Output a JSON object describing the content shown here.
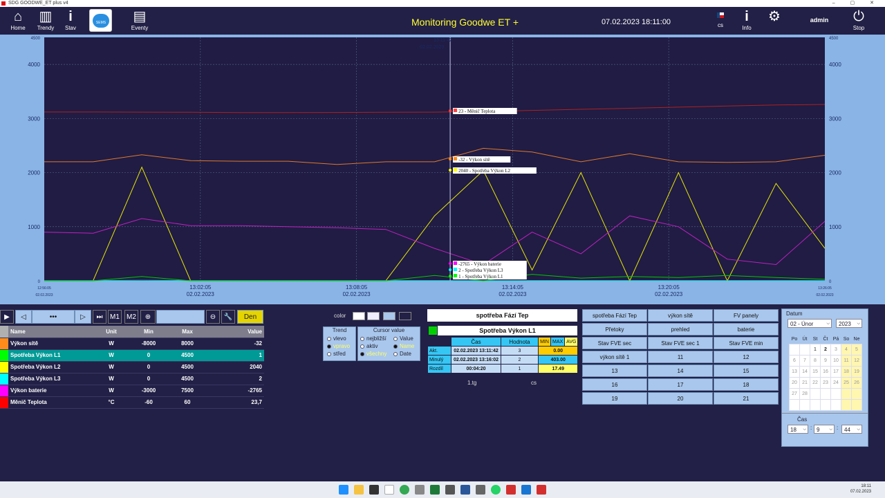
{
  "window": {
    "title": "SDG GOODWE_ET plus  v4",
    "controls": "–  ▢  ✕"
  },
  "nav": [
    {
      "label": "Home",
      "icon": "home-icon",
      "glyph": "⌂"
    },
    {
      "label": "Trendy",
      "icon": "trend-icon",
      "glyph": "▥"
    },
    {
      "label": "Stav",
      "icon": "info-icon",
      "glyph": "i"
    },
    {
      "label": "",
      "icon": "sems-cloud-icon",
      "glyph": "SEMS"
    },
    {
      "label": "Eventy",
      "icon": "events-icon",
      "glyph": "▤"
    }
  ],
  "header": {
    "title": "Monitoring Goodwe ET +",
    "datetime": "07.02.2023 18:11:00",
    "lang": "cs",
    "info_label": "Info",
    "user": "admin",
    "stop_label": "Stop"
  },
  "chart_data": {
    "type": "line",
    "ylim": [
      0,
      4500
    ],
    "y_ticks": [
      "4500",
      "4000",
      "3000",
      "2000",
      "1000",
      "0"
    ],
    "x_ticks": [
      {
        "time": "12:56:05",
        "date": "02.02.2023"
      },
      {
        "time": "13:02:05",
        "date": "02.02.2023"
      },
      {
        "time": "13:08:05",
        "date": "02.02.2023"
      },
      {
        "time": "13:14:05",
        "date": "02.02.2023"
      },
      {
        "time": "13:20:05",
        "date": "02.02.2023"
      },
      {
        "time": "13:26:05",
        "date": "02.02.2023"
      }
    ],
    "cursor": {
      "time": "13:11:42",
      "date": "02.02.2023"
    },
    "cursor_labels": [
      {
        "text": "23 - Měnič Teplota",
        "color": "#ff4040"
      },
      {
        "text": "-32 - Výkon sítě",
        "color": "#ff8c1a"
      },
      {
        "text": "2040 - Spotřeba Výkon L2",
        "color": "#ffff00"
      },
      {
        "text": "-2765 - Výkon baterie",
        "color": "#ff00ff"
      },
      {
        "text": "2 - Spotřeba Výkon L3",
        "color": "#00ffff"
      },
      {
        "text": "1 - Spotřeba Výkon L1",
        "color": "#00ff00"
      }
    ],
    "series": [
      {
        "name": "Měnič Teplota",
        "color": "#b02020",
        "values": [
          3120,
          3120,
          3118,
          3115,
          3110,
          3110,
          3112,
          3115,
          3118,
          3130,
          3150,
          3170,
          3190,
          3210,
          3230,
          3250,
          3260
        ]
      },
      {
        "name": "Výkon sítě",
        "color": "#e0782a",
        "values": [
          2200,
          2200,
          2330,
          2220,
          2210,
          2210,
          2150,
          2200,
          2200,
          2450,
          2380,
          2200,
          2350,
          2200,
          2190,
          2200,
          2320
        ]
      },
      {
        "name": "Spotřeba Výkon L2",
        "color": "#e8e800",
        "values": [
          0,
          0,
          2100,
          0,
          0,
          0,
          0,
          0,
          1200,
          2040,
          200,
          2000,
          0,
          2000,
          0,
          1800,
          600
        ]
      },
      {
        "name": "Výkon baterie",
        "color": "#c020c0",
        "values": [
          900,
          880,
          1150,
          1020,
          1020,
          1000,
          980,
          950,
          600,
          300,
          900,
          500,
          1200,
          1000,
          400,
          300,
          1100
        ]
      },
      {
        "name": "Spotřeba Výkon L3",
        "color": "#00d8d8",
        "values": [
          5,
          5,
          10,
          5,
          5,
          5,
          5,
          5,
          5,
          2,
          5,
          5,
          5,
          5,
          5,
          5,
          5
        ]
      },
      {
        "name": "Spotřeba Výkon L1",
        "color": "#00c800",
        "values": [
          0,
          0,
          80,
          0,
          0,
          0,
          0,
          0,
          100,
          1,
          120,
          50,
          80,
          60,
          100,
          60,
          30
        ]
      }
    ]
  },
  "controls": {
    "m1": "M1",
    "m2": "M2",
    "dots": "•••",
    "period": "Den"
  },
  "signals": {
    "headers": [
      "Name",
      "Unit",
      "Min",
      "Max",
      "Value"
    ],
    "rows": [
      {
        "color": "#ff8c1a",
        "name": "Výkon sítě",
        "unit": "W",
        "min": "-8000",
        "max": "8000",
        "value": "-32"
      },
      {
        "color": "#00ff00",
        "name": "Spotřeba Výkon L1",
        "unit": "W",
        "min": "0",
        "max": "4500",
        "value": "1"
      },
      {
        "color": "#ffff00",
        "name": "Spotřeba Výkon L2",
        "unit": "W",
        "min": "0",
        "max": "4500",
        "value": "2040"
      },
      {
        "color": "#00ffff",
        "name": "Spotřeba Výkon L3",
        "unit": "W",
        "min": "0",
        "max": "4500",
        "value": "2"
      },
      {
        "color": "#ff00ff",
        "name": "Výkon baterie",
        "unit": "W",
        "min": "-3000",
        "max": "7500",
        "value": "-2765"
      },
      {
        "color": "#ff0000",
        "name": "Měnič Teplota",
        "unit": "°C",
        "min": "-60",
        "max": "60",
        "value": "23,7"
      }
    ]
  },
  "options": {
    "color_label": "color",
    "trend_title": "Trend",
    "trend": [
      "vlevo",
      "vpravo",
      "střed"
    ],
    "cursor_title": "Cursor value",
    "cursor_a": [
      "nejbližší",
      "aktiv",
      "všechny"
    ],
    "cursor_b": [
      "Value",
      "Name",
      "Date"
    ]
  },
  "cursor_info": {
    "title": "spotřeba Fází Tep",
    "signal": "Spotřeba Výkon L1",
    "headers": [
      "Čas",
      "Hodnota"
    ],
    "stat_headers": [
      "MIN",
      "MAX",
      "AVG"
    ],
    "rows": [
      {
        "label": "Akt.",
        "time": "02.02.2023 13:11:42",
        "value": "3",
        "stat": "0.00"
      },
      {
        "label": "Minulý",
        "time": "02.02.2023 13:16:02",
        "value": "2",
        "stat": "403.00"
      },
      {
        "label": "Rozdíl",
        "time": "00:04:20",
        "value": "1",
        "stat": "17.49"
      }
    ],
    "file": "1.tg",
    "lang": "cs"
  },
  "trend_buttons": [
    "spotřeba Fází Tep",
    "výkon sítě",
    "FV panely",
    "Přetoky",
    "prehled",
    "baterie",
    "Stav FVE sec",
    "Stav FVE sec 1",
    "Stav FVE min",
    "výkon sítě 1",
    "11",
    "12",
    "13",
    "14",
    "15",
    "16",
    "17",
    "18",
    "19",
    "20",
    "21"
  ],
  "date_panel": {
    "title": "Datum",
    "month": "02 - Únor",
    "year": "2023",
    "weekdays": [
      "Po",
      "Út",
      "St",
      "Čt",
      "Pá",
      "So",
      "Ne"
    ],
    "weeks": [
      [
        "",
        "",
        "1",
        "2",
        "3",
        "4",
        "5"
      ],
      [
        "6",
        "7",
        "8",
        "9",
        "10",
        "11",
        "12"
      ],
      [
        "13",
        "14",
        "15",
        "16",
        "17",
        "18",
        "19"
      ],
      [
        "20",
        "21",
        "22",
        "23",
        "24",
        "25",
        "26"
      ],
      [
        "27",
        "28",
        "",
        "",
        "",
        "",
        ""
      ],
      [
        "",
        "",
        "",
        "",
        "",
        "",
        ""
      ]
    ],
    "time_title": "Čas",
    "hour": "18",
    "minute": "9",
    "second": "44"
  },
  "taskbar": {
    "time": "18:11",
    "date": "07.02.2023"
  }
}
